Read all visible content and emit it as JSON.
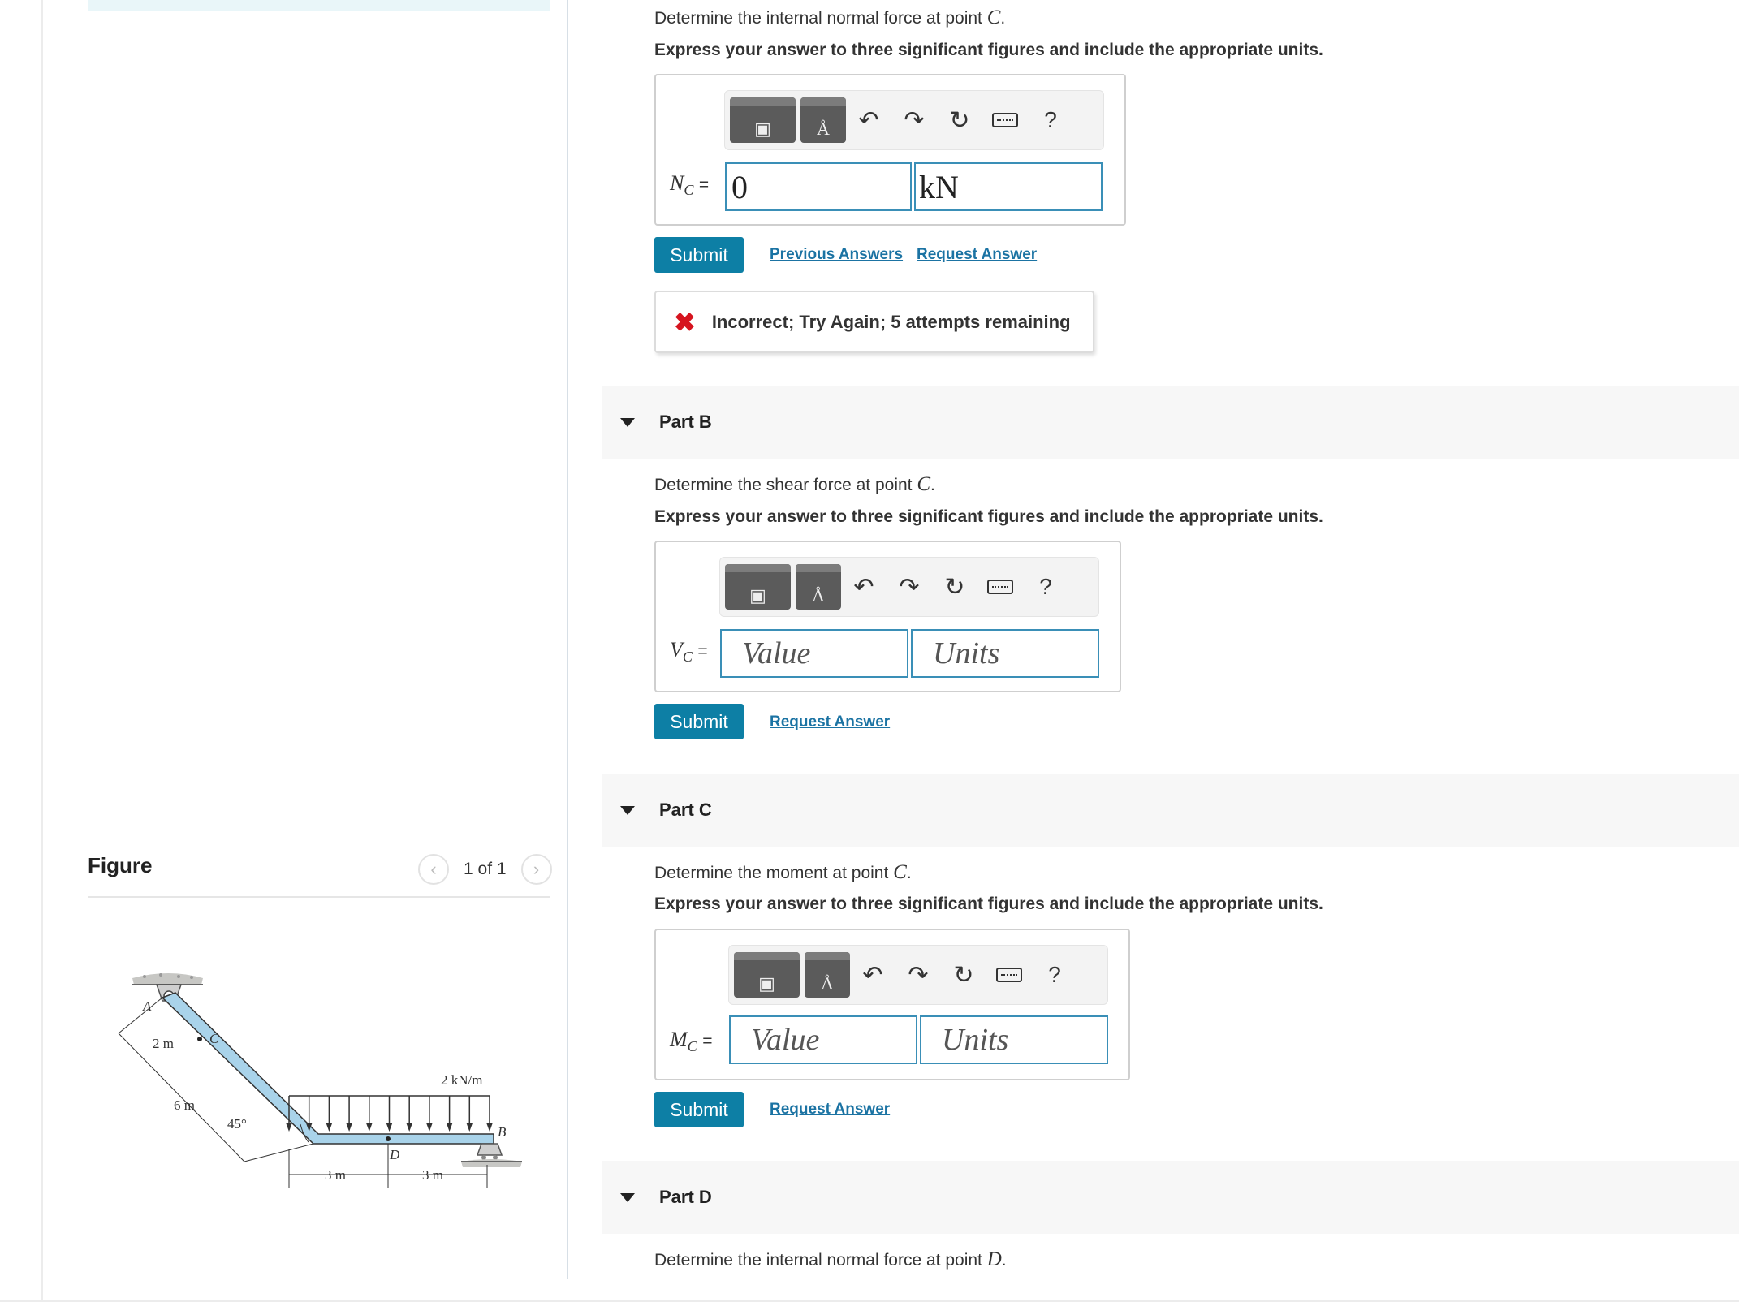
{
  "figure": {
    "title": "Figure",
    "counter": "1 of 1",
    "labels": {
      "A": "A",
      "B": "B",
      "C": "C",
      "D": "D",
      "dim_2m": "2 m",
      "dim_6m": "6 m",
      "angle": "45°",
      "load": "2 kN/m",
      "dim_3m_left": "3 m",
      "dim_3m_right": "3 m"
    }
  },
  "partA": {
    "prompt_prefix": "Determine the internal normal force at point",
    "point": "C",
    "prompt_suffix": ".",
    "instruction": "Express your answer to three significant figures and include the appropriate units.",
    "var": "N",
    "sub": "C",
    "eq": "=",
    "value": "0",
    "units": "kN",
    "submit": "Submit",
    "previous_answers": "Previous Answers",
    "request_answer": "Request Answer",
    "feedback": "Incorrect; Try Again; 5 attempts remaining"
  },
  "partB": {
    "title": "Part B",
    "prompt_prefix": "Determine the shear force at point",
    "point": "C",
    "prompt_suffix": ".",
    "instruction": "Express your answer to three significant figures and include the appropriate units.",
    "var": "V",
    "sub": "C",
    "eq": "=",
    "value_placeholder": "Value",
    "units_placeholder": "Units",
    "submit": "Submit",
    "request_answer": "Request Answer"
  },
  "partC": {
    "title": "Part C",
    "prompt_prefix": "Determine the moment at point",
    "point": "C",
    "prompt_suffix": ".",
    "instruction": "Express your answer to three significant figures and include the appropriate units.",
    "var": "M",
    "sub": "C",
    "eq": "=",
    "value_placeholder": "Value",
    "units_placeholder": "Units",
    "submit": "Submit",
    "request_answer": "Request Answer"
  },
  "partD": {
    "title": "Part D",
    "prompt_prefix": "Determine the internal normal force at point",
    "point": "D",
    "prompt_suffix": "."
  },
  "toolbar": {
    "units_glyph": "Å",
    "help": "?",
    "icons": [
      "templates-icon",
      "units-icon",
      "undo-icon",
      "redo-icon",
      "reset-icon",
      "keyboard-icon",
      "help-icon"
    ]
  },
  "colors": {
    "accent": "#0d7fa5",
    "link": "#1b73a3",
    "field_border": "#3a8fb7",
    "error": "#d6141f",
    "beam": "#a9d3ea"
  }
}
